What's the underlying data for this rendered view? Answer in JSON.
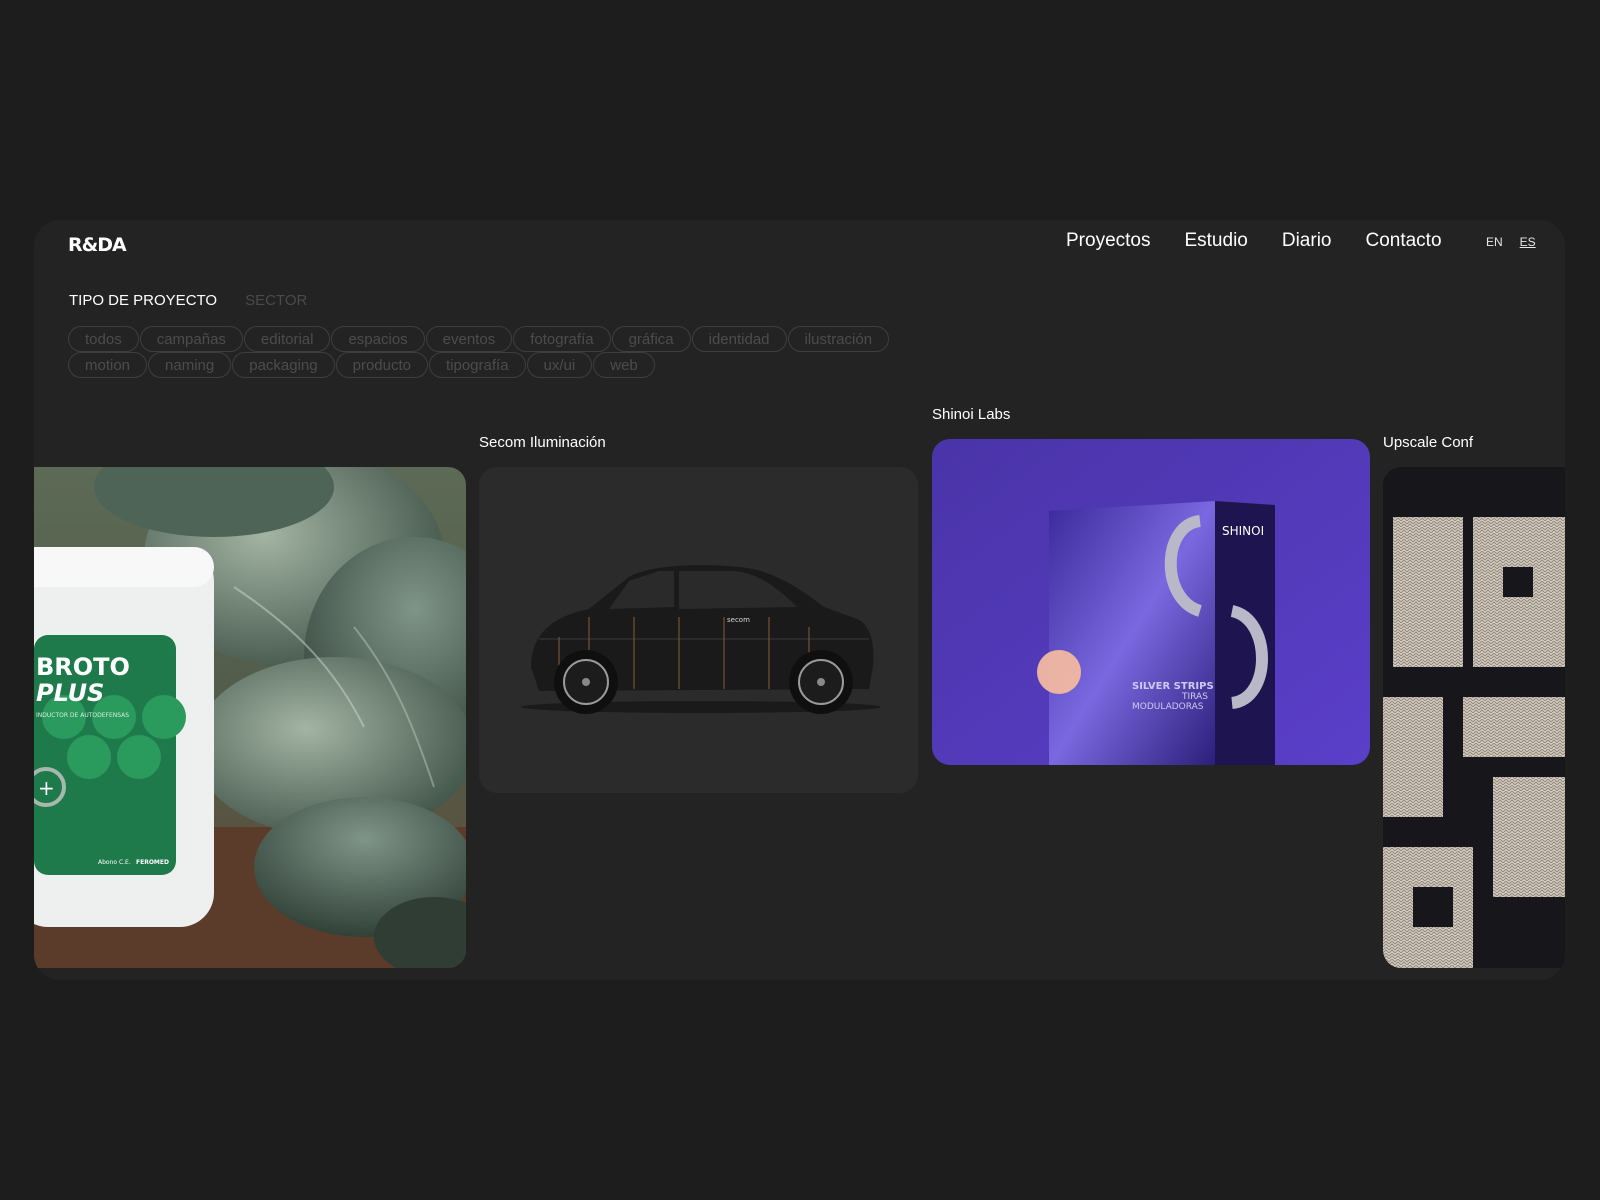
{
  "brand": {
    "logo": "R&DA"
  },
  "nav": {
    "items": [
      "Proyectos",
      "Estudio",
      "Diario",
      "Contacto"
    ]
  },
  "lang": {
    "en": "EN",
    "es": "ES"
  },
  "filters": {
    "tabs": [
      "TIPO DE PROYECTO",
      "SECTOR"
    ],
    "chips": [
      "todos",
      "campañas",
      "editorial",
      "espacios",
      "eventos",
      "fotografía",
      "gráfica",
      "identidad",
      "ilustración",
      "motion",
      "naming",
      "packaging",
      "producto",
      "tipografía",
      "ux/ui",
      "web"
    ]
  },
  "projects": [
    {
      "title": "",
      "image": "broto-plus-bottle-in-crop-field",
      "label_line1": "BROTO",
      "label_line2": "PLUS",
      "label_sub": "INDUCTOR DE AUTODEFENSAS",
      "label_foot": "Abono C.E.",
      "label_brand": "FEROMED"
    },
    {
      "title": "Secom Iluminación",
      "image": "black-car-side-view",
      "car_text": "secom"
    },
    {
      "title": "Shinoi Labs",
      "image": "purple-product-box",
      "box_brand": "SHINOI",
      "box_line1": "SILVER STRIPS",
      "box_line2": "TIRAS",
      "box_line3": "MODULADORAS"
    },
    {
      "title": "Upscale Conf",
      "image": "knitted-pixel-letters"
    }
  ],
  "colors": {
    "background": "#1d1d1d",
    "panel": "#232323",
    "accent_purple": "#5b3fc4",
    "cursor": "#f2b8a0"
  }
}
